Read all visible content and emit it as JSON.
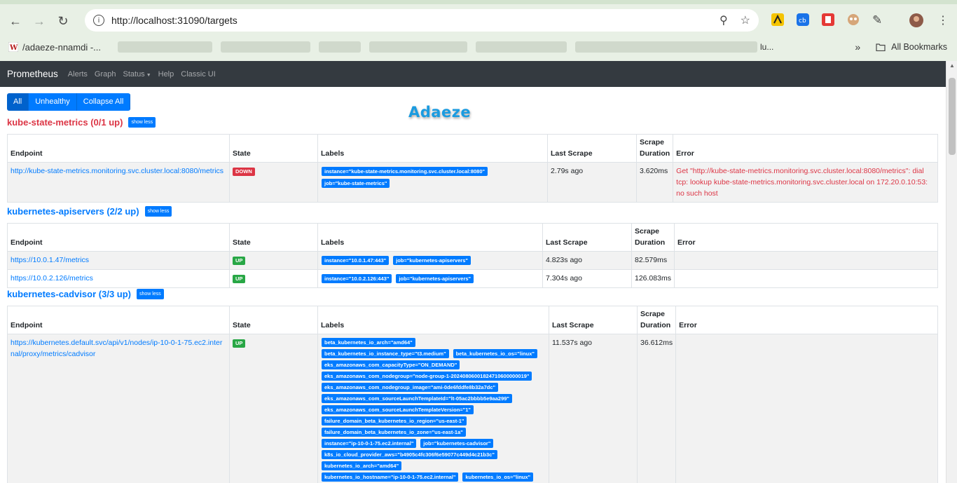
{
  "browser": {
    "url": "http://localhost:31090/targets",
    "bookmarks": [
      {
        "label": "/adaeze-nnamdi -..."
      },
      {
        "label": "lu..."
      }
    ],
    "all_bookmarks": "All Bookmarks"
  },
  "nav": {
    "brand": "Prometheus",
    "links": [
      "Alerts",
      "Graph",
      "Status",
      "Help",
      "Classic UI"
    ]
  },
  "filters": [
    "All",
    "Unhealthy",
    "Collapse All"
  ],
  "watermark": "Adaeze",
  "show_less": "show less",
  "columns": [
    "Endpoint",
    "State",
    "Labels",
    "Last Scrape",
    "Scrape Duration",
    "Error"
  ],
  "pools": [
    {
      "title": "kube-state-metrics (0/1 up)",
      "targets": [
        {
          "endpoint": "http://kube-state-metrics.monitoring.svc.cluster.local:8080/metrics",
          "state": "DOWN",
          "labels": [
            "instance=\"kube-state-metrics.monitoring.svc.cluster.local:8080\"",
            "job=\"kube-state-metrics\""
          ],
          "last_scrape": "2.79s ago",
          "duration": "3.620ms",
          "error": "Get \"http://kube-state-metrics.monitoring.svc.cluster.local:8080/metrics\": dial tcp: lookup kube-state-metrics.monitoring.svc.cluster.local on 172.20.0.10:53: no such host"
        }
      ]
    },
    {
      "title": "kubernetes-apiservers (2/2 up)",
      "targets": [
        {
          "endpoint": "https://10.0.1.47/metrics",
          "state": "UP",
          "labels": [
            "instance=\"10.0.1.47:443\"",
            "job=\"kubernetes-apiservers\""
          ],
          "last_scrape": "4.823s ago",
          "duration": "82.579ms",
          "error": ""
        },
        {
          "endpoint": "https://10.0.2.126/metrics",
          "state": "UP",
          "labels": [
            "instance=\"10.0.2.126:443\"",
            "job=\"kubernetes-apiservers\""
          ],
          "last_scrape": "7.304s ago",
          "duration": "126.083ms",
          "error": ""
        }
      ]
    },
    {
      "title": "kubernetes-cadvisor (3/3 up)",
      "targets": [
        {
          "endpoint": "https://kubernetes.default.svc/api/v1/nodes/ip-10-0-1-75.ec2.internal/proxy/metrics/cadvisor",
          "state": "UP",
          "labels": [
            "beta_kubernetes_io_arch=\"amd64\"",
            "beta_kubernetes_io_instance_type=\"t3.medium\"",
            "beta_kubernetes_io_os=\"linux\"",
            "eks_amazonaws_com_capacityType=\"ON_DEMAND\"",
            "eks_amazonaws_com_nodegroup=\"node-group-1-20240806001824710600000019\"",
            "eks_amazonaws_com_nodegroup_image=\"ami-0de6fddfe8b32a7dc\"",
            "eks_amazonaws_com_sourceLaunchTemplateId=\"lt-05ac2bbbb5e9aa299\"",
            "eks_amazonaws_com_sourceLaunchTemplateVersion=\"1\"",
            "failure_domain_beta_kubernetes_io_region=\"us-east-1\"",
            "failure_domain_beta_kubernetes_io_zone=\"us-east-1a\"",
            "instance=\"ip-10-0-1-75.ec2.internal\"",
            "job=\"kubernetes-cadvisor\"",
            "k8s_io_cloud_provider_aws=\"b4905c4fc306f6e59077c449d4c21b3c\"",
            "kubernetes_io_arch=\"amd64\"",
            "kubernetes_io_hostname=\"ip-10-0-1-75.ec2.internal\"",
            "kubernetes_io_os=\"linux\""
          ],
          "last_scrape": "11.537s ago",
          "duration": "36.612ms",
          "error": ""
        }
      ]
    }
  ]
}
